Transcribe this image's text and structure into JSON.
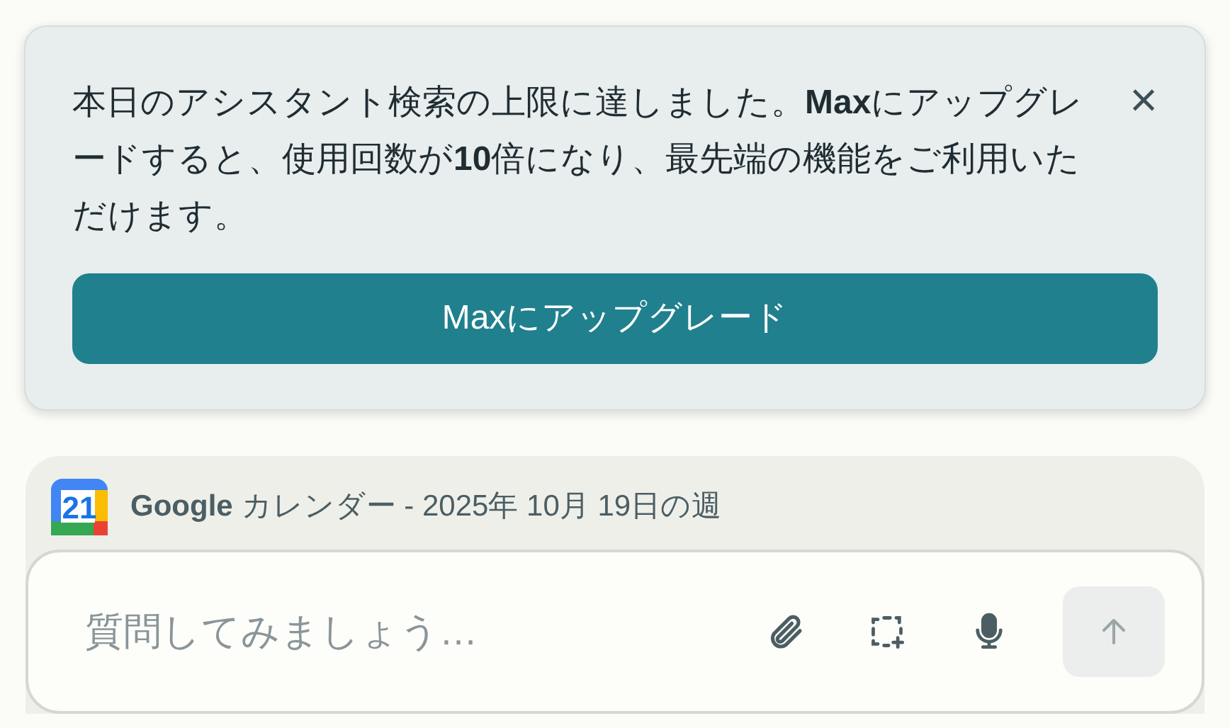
{
  "notice": {
    "message": "本日のアシスタント検索の上限に達しました。**Max**にアップグレードすると、使用回数が**10**倍になり、最先端の機能をご利用いただけます。",
    "close": "×",
    "button": "Maxにアップグレード"
  },
  "context": {
    "calendar_day": "21",
    "source": "Google",
    "title": "カレンダー - 2025年 10月 19日の週"
  },
  "composer": {
    "placeholder": "質問してみましょう…"
  }
}
